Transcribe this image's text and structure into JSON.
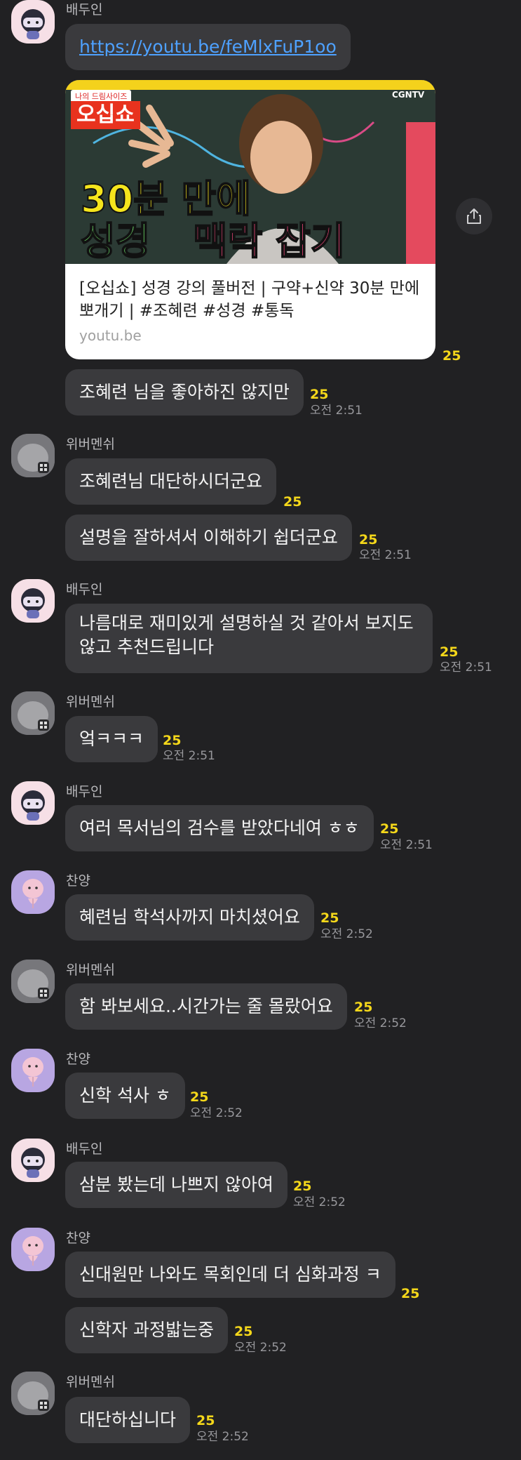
{
  "senders": {
    "baeduin": "배두인",
    "wiber": "위버멘쉬",
    "chanyang": "찬양"
  },
  "messages": {
    "m0": {
      "link": "https://youtu.be/feMlxFuP1oo"
    },
    "card": {
      "badge": "나의 드림사이즈",
      "show": "오십쇼",
      "channel": "CGNTV",
      "line1": "30분 만에",
      "line2a": "성경",
      "line2b": "맥락 잡기",
      "title": "[오십쇼] 성경 강의 풀버전 | 구약+신약 30분 만에 뽀개기 | #조혜련 #성경 #통독",
      "domain": "youtu.be",
      "count": "25"
    },
    "m1": {
      "text": "조혜련 님을 좋아하진 않지만",
      "count": "25",
      "time": "오전 2:51"
    },
    "m2": {
      "text": "조혜련님 대단하시더군요",
      "count": "25"
    },
    "m3": {
      "text": "설명을 잘하셔서 이해하기 쉽더군요",
      "count": "25",
      "time": "오전 2:51"
    },
    "m4": {
      "text": "나름대로 재미있게 설명하실 것 같아서 보지도 않고 추천드립니다",
      "count": "25",
      "time": "오전 2:51"
    },
    "m5": {
      "text": "엌ㅋㅋㅋ",
      "count": "25",
      "time": "오전 2:51"
    },
    "m6": {
      "text": "여러 목서님의 검수를 받았다네여 ㅎㅎ",
      "count": "25",
      "time": "오전 2:51"
    },
    "m7": {
      "text": "혜련님 학석사까지 마치셨어요",
      "count": "25",
      "time": "오전 2:52"
    },
    "m8": {
      "text": "함 봐보세요..시간가는 줄 몰랐어요",
      "count": "25",
      "time": "오전 2:52"
    },
    "m9": {
      "text": "신학 석사 ㅎ",
      "count": "25",
      "time": "오전 2:52"
    },
    "m10": {
      "text": "삼분 봤는데 나쁘지 않아여",
      "count": "25",
      "time": "오전 2:52"
    },
    "m11": {
      "text": "신대원만 나와도 목회인데 더 심화과정 ㅋ",
      "count": "25"
    },
    "m12": {
      "text": "신학자 과정밟는중",
      "count": "25",
      "time": "오전 2:52"
    },
    "m13": {
      "text": "대단하십니다",
      "count": "25",
      "time": "오전 2:52"
    }
  },
  "icons": {
    "share": "share-icon",
    "avatar_overlay": "grid-badge-icon"
  },
  "colors": {
    "background": "#212123",
    "bubble": "#3a3a3d",
    "read_count": "#f4d71a",
    "link": "#4ea1ff"
  }
}
